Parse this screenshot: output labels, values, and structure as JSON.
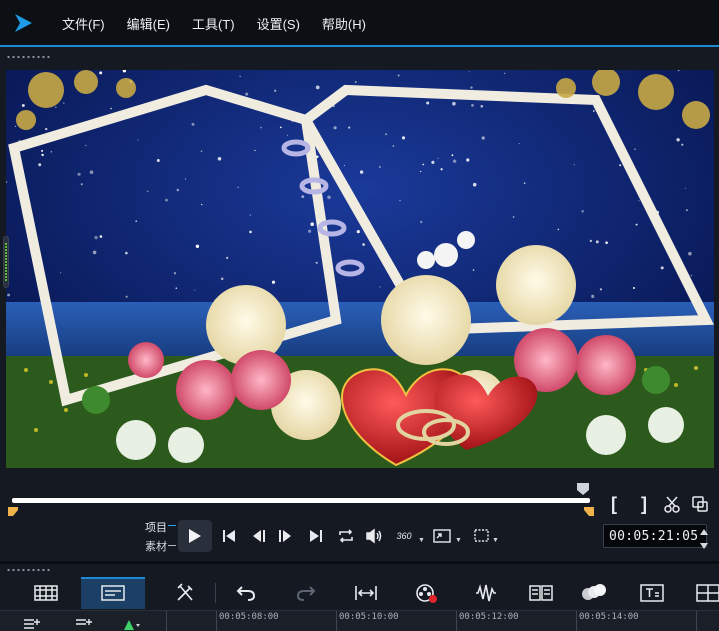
{
  "menu": {
    "items": [
      {
        "label": "文件(F)"
      },
      {
        "label": "编辑(E)"
      },
      {
        "label": "工具(T)"
      },
      {
        "label": "设置(S)"
      },
      {
        "label": "帮助(H)"
      }
    ]
  },
  "player": {
    "mode_project": "项目",
    "mode_clip": "素材",
    "timecode": "00:05:21:05",
    "trim_in_label": "[",
    "trim_out_label": "]",
    "vr_label": "360",
    "playhead_position": 1.0
  },
  "timeline": {
    "ruler": [
      "00:05:08:00",
      "00:05:10:00",
      "00:05:12:00",
      "00:05:14:00"
    ]
  },
  "colors": {
    "accent": "#1e8ad6",
    "mode_active": "#2aa0f0",
    "trim_marker": "#f0b24a",
    "menubar_bg": "#0c0f14",
    "app_bg": "#151a22"
  },
  "icons": [
    "app-logo-icon",
    "play-icon",
    "go-to-start-icon",
    "previous-frame-icon",
    "next-frame-icon",
    "go-to-end-icon",
    "repeat-icon",
    "volume-icon",
    "360-view-icon",
    "enlarge-icon",
    "crop-icon",
    "scissors-icon",
    "copy-icon",
    "storyboard-view-icon",
    "timeline-view-icon",
    "tools-icon",
    "undo-icon",
    "redo-icon",
    "fit-timeline-icon",
    "record-capture-icon",
    "audio-icon",
    "multi-camera-icon",
    "color-icon",
    "title-icon",
    "add-track-icon",
    "track-options-icon",
    "marker-icon"
  ]
}
